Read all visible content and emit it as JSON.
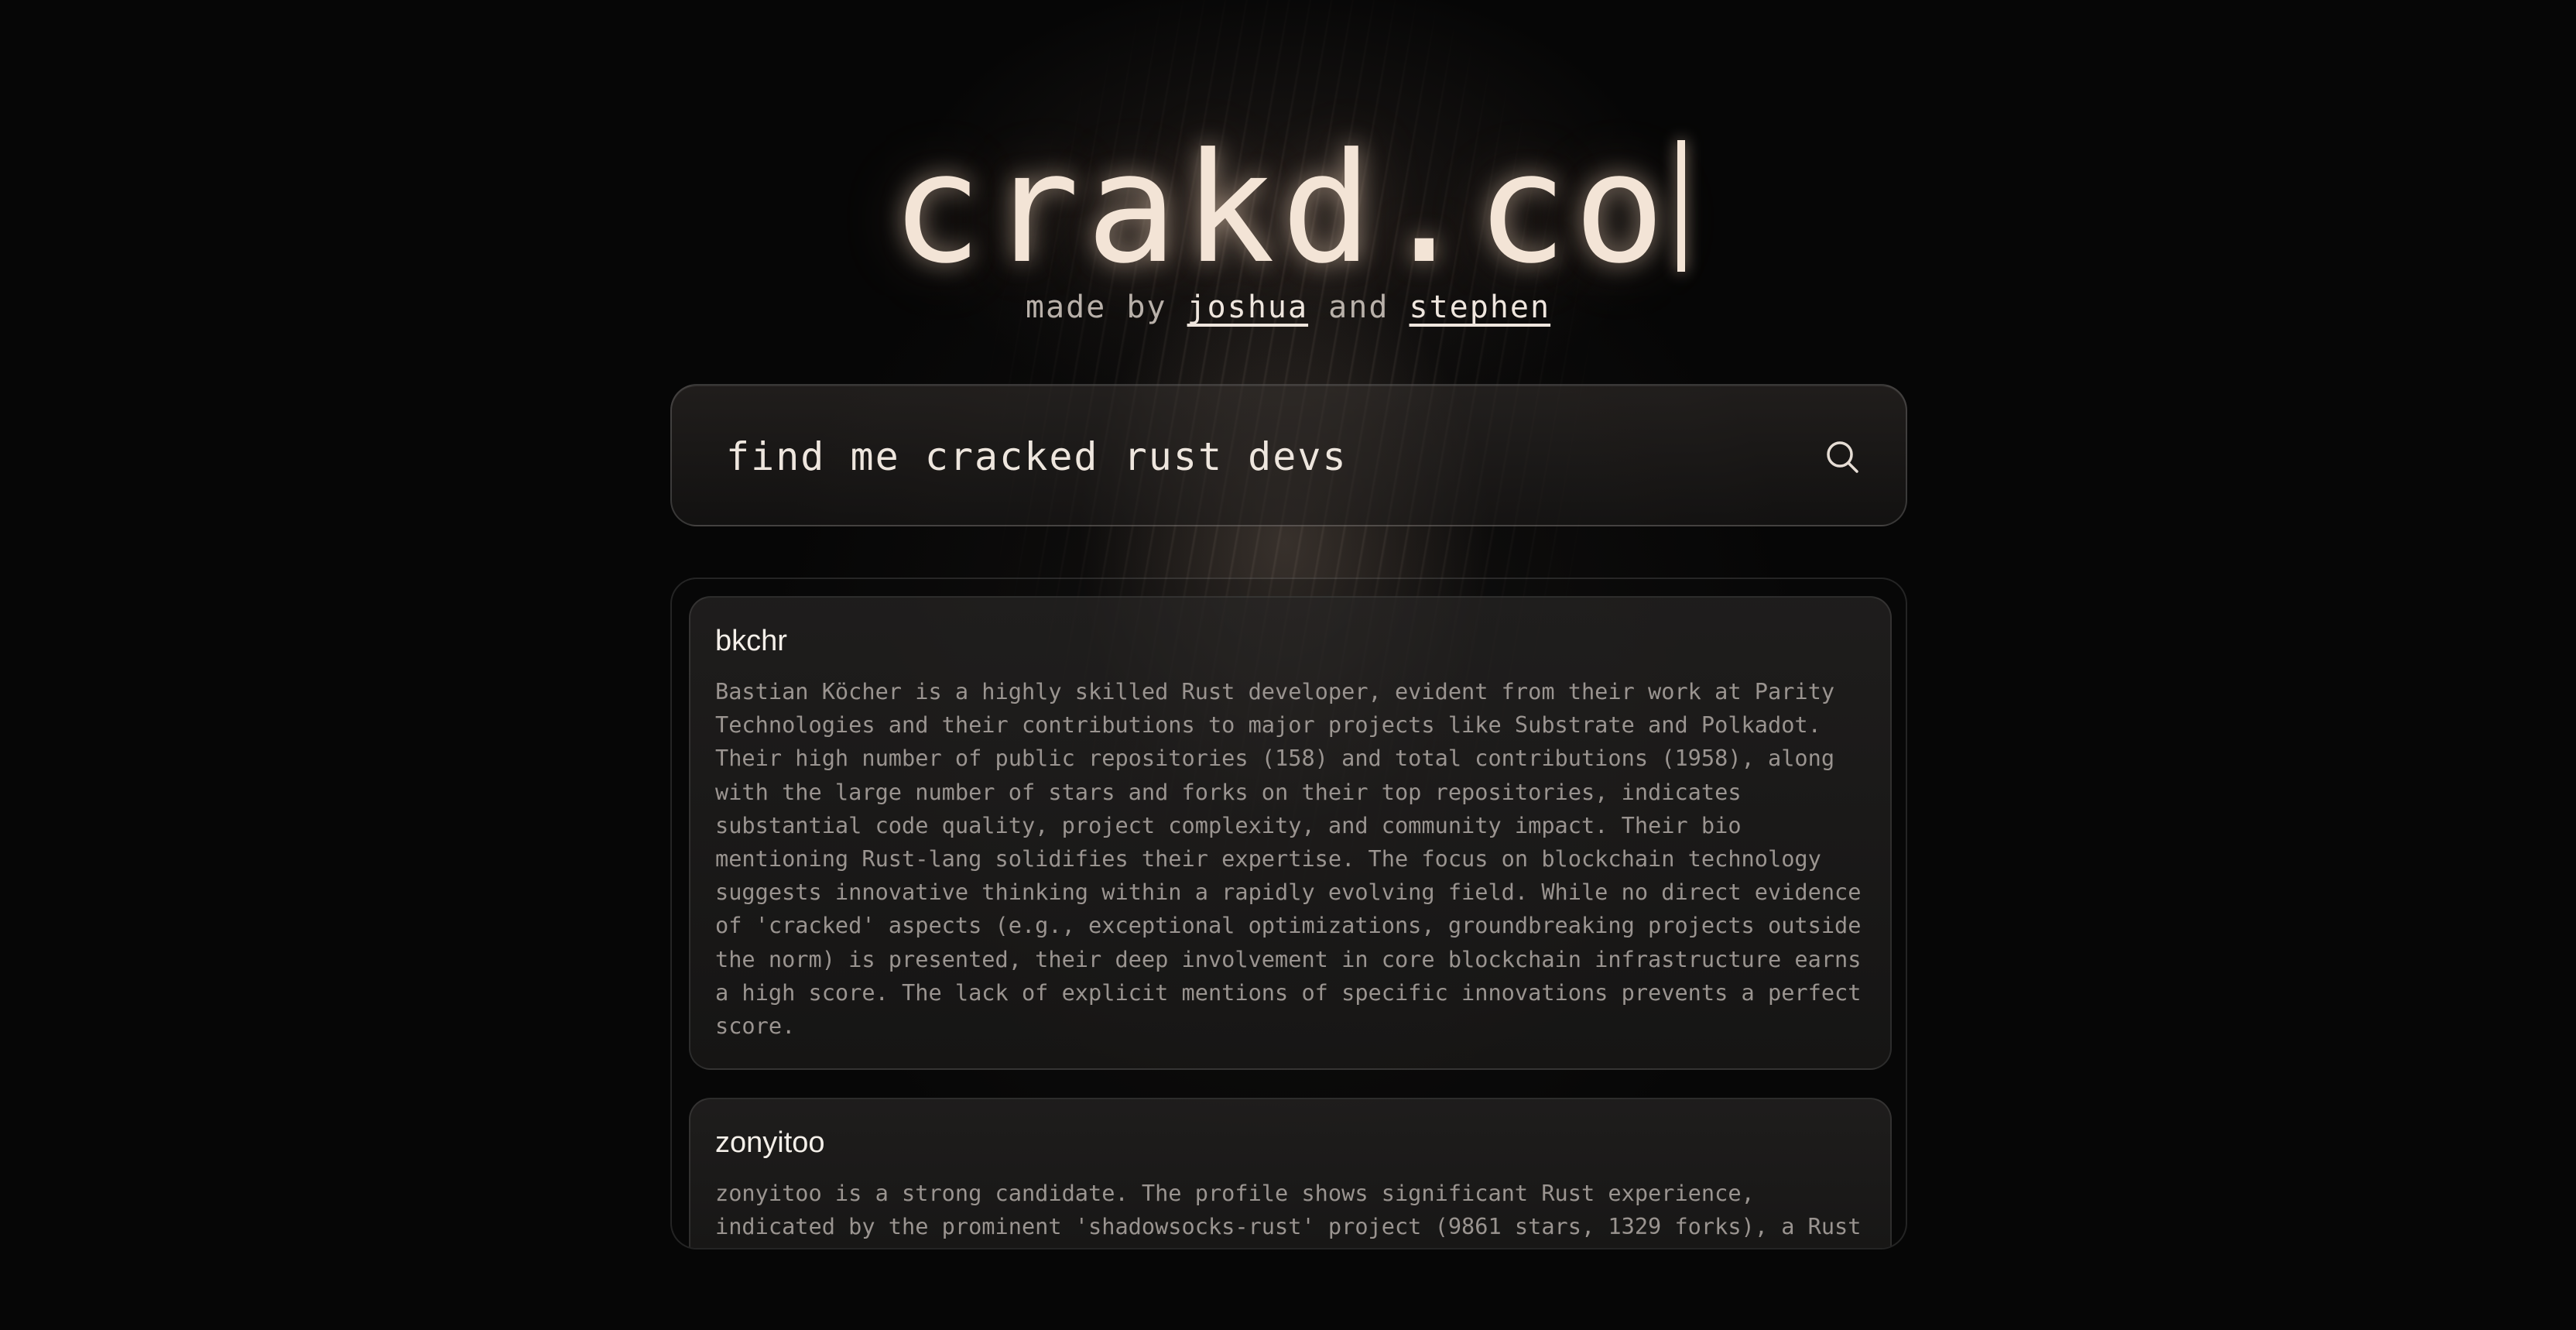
{
  "header": {
    "title": "crakd.co",
    "made_by": "made by",
    "and": "and",
    "author_1": "joshua",
    "author_2": "stephen"
  },
  "search": {
    "value": "find me cracked rust devs",
    "icon": "search-icon"
  },
  "results": [
    {
      "name": "bkchr",
      "summary": "Bastian Köcher is a highly skilled Rust developer, evident from their work at Parity Technologies and their contributions to major projects like Substrate and Polkadot. Their high number of public repositories (158) and total contributions (1958), along with the large number of stars and forks on their top repositories, indicates substantial code quality, project complexity, and community impact. Their bio mentioning Rust-lang solidifies their expertise. The focus on blockchain technology suggests innovative thinking within a rapidly evolving field. While no direct evidence of 'cracked' aspects (e.g., exceptional optimizations, groundbreaking projects outside the norm) is presented, their deep involvement in core blockchain infrastructure earns a high score. The lack of explicit mentions of specific innovations prevents a perfect score."
    },
    {
      "name": "zonyitoo",
      "summary": "zonyitoo is a strong candidate. The profile shows significant Rust experience, indicated by the prominent 'shadowsocks-rust' project (9861 stars, 1329 forks), a Rust"
    }
  ]
}
